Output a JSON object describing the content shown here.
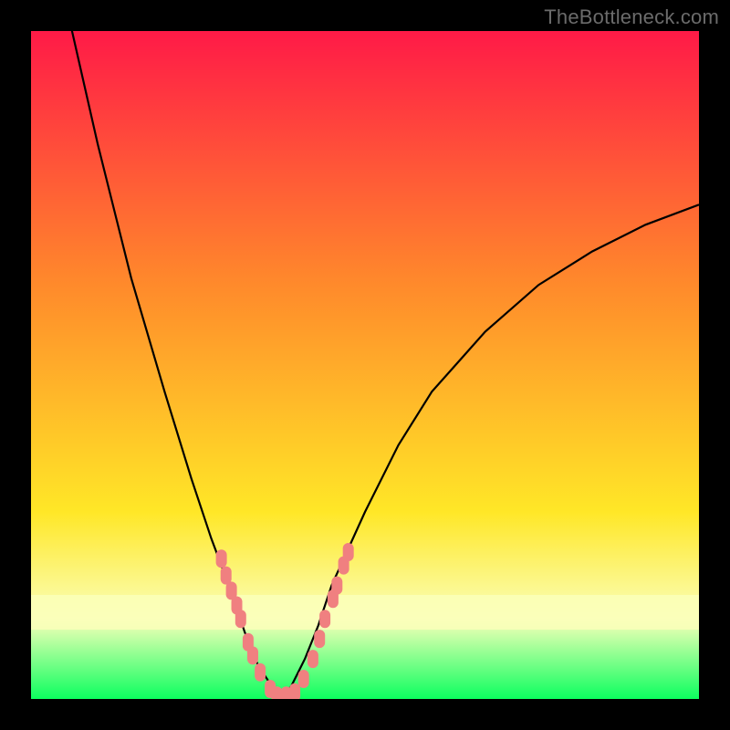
{
  "watermark": "TheBottleneck.com",
  "chart_data": {
    "type": "line",
    "title": "",
    "xlabel": "",
    "ylabel": "",
    "xlim": [
      0,
      100
    ],
    "ylim": [
      0,
      100
    ],
    "grid": false,
    "legend": false,
    "background_gradient": {
      "top": "#ff1a47",
      "mid1": "#ff8a2b",
      "mid2": "#ffe727",
      "band": "#faffba",
      "bottom": "#0cff5f"
    },
    "curve": {
      "description": "V-shaped bottleneck curve; low y = good match",
      "x": [
        0,
        5,
        10,
        15,
        20,
        24,
        27,
        30,
        32,
        34,
        36,
        37.5,
        39,
        41,
        43,
        45,
        50,
        55,
        60,
        68,
        76,
        84,
        92,
        100
      ],
      "y": [
        130,
        105,
        83,
        63,
        46,
        33,
        24,
        16,
        10,
        5,
        2,
        0,
        2,
        6,
        11,
        17,
        28,
        38,
        46,
        55,
        62,
        67,
        71,
        74
      ]
    },
    "highlight_points": {
      "description": "Pink markers near the minimum on both arms of the V",
      "color": "#f08080",
      "points": [
        {
          "x": 28.5,
          "y": 21
        },
        {
          "x": 29.2,
          "y": 18.5
        },
        {
          "x": 30.0,
          "y": 16.2
        },
        {
          "x": 30.8,
          "y": 14
        },
        {
          "x": 31.4,
          "y": 12
        },
        {
          "x": 32.5,
          "y": 8.5
        },
        {
          "x": 33.2,
          "y": 6.5
        },
        {
          "x": 34.3,
          "y": 4
        },
        {
          "x": 35.8,
          "y": 1.5
        },
        {
          "x": 36.8,
          "y": 0.5
        },
        {
          "x": 38.2,
          "y": 0.5
        },
        {
          "x": 39.5,
          "y": 1
        },
        {
          "x": 40.8,
          "y": 3
        },
        {
          "x": 42.2,
          "y": 6
        },
        {
          "x": 43.2,
          "y": 9
        },
        {
          "x": 44.0,
          "y": 12
        },
        {
          "x": 45.2,
          "y": 15
        },
        {
          "x": 45.8,
          "y": 17
        },
        {
          "x": 46.8,
          "y": 20
        },
        {
          "x": 47.5,
          "y": 22
        }
      ]
    }
  }
}
